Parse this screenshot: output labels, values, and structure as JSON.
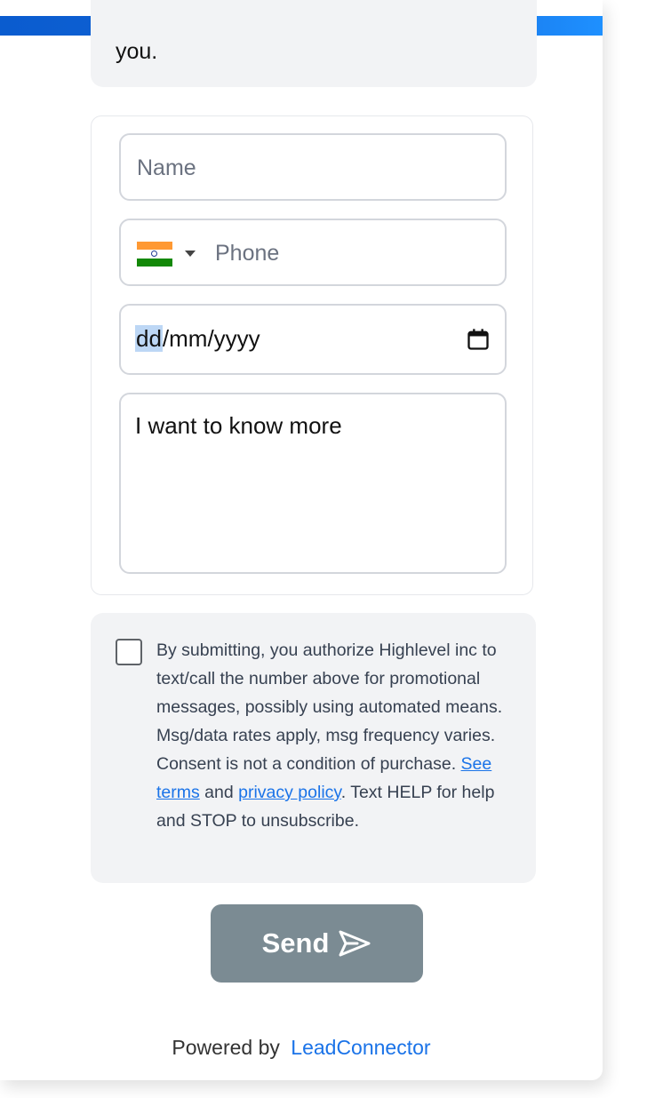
{
  "message": {
    "text": "you."
  },
  "form": {
    "name_placeholder": "Name",
    "phone_placeholder": "Phone",
    "phone_country": "india-flag-icon",
    "date_value_day": "dd",
    "date_value_rest": "/mm/yyyy",
    "message_value": "I want to know more"
  },
  "consent": {
    "text_before": "By submitting, you authorize Highlevel inc to text/call the number above for promotional messages, possibly using automated means. Msg/data rates apply, msg frequency varies. Consent is not a condition of purchase. ",
    "terms_link": "See terms",
    "and": " and ",
    "privacy_link": "privacy policy",
    "text_after": ". Text HELP for help and STOP to unsubscribe."
  },
  "send_button": {
    "label": "Send"
  },
  "footer": {
    "powered_by": "Powered by",
    "brand": "LeadConnector"
  },
  "colors": {
    "accent": "#1a73e8",
    "send_button": "#7b8b93",
    "top_bar": "#1565d8"
  }
}
